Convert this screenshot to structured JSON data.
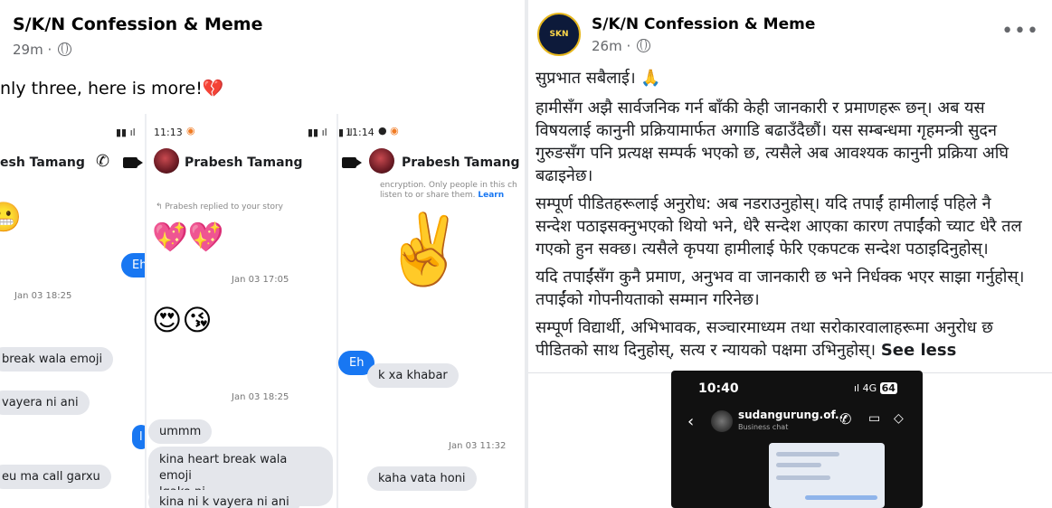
{
  "left_post": {
    "page_name": "S/K/N Confession & Meme",
    "time": "29m",
    "text": "nly three, here is more!",
    "heart_icon": "broken-heart",
    "screenshots": [
      {
        "chat_name": "esh Tamang",
        "messages": {
          "sent1": "Eh",
          "ts1": "Jan 03 18:25",
          "recv1": "break wala emoji",
          "recv2": "vayera ni ani",
          "recv3": "eu ma call garxu"
        }
      },
      {
        "status_time": "11:13",
        "chat_name": "Prabesh Tamang",
        "reply_note": "Prabesh replied to your story",
        "ts1": "Jan 03 17:05",
        "ts2": "Jan 03 18:25",
        "recv1": "ummm",
        "recv2a": "kina heart break wala emoji",
        "recv2b": "lgako ni",
        "recv3": "kina ni k vayera ni ani"
      },
      {
        "status_time": "11:14",
        "chat_name": "Prabesh Tamang",
        "note1": "encryption. Only people in this ch",
        "note2": "listen to or share them.",
        "note_link": "Learn",
        "sent1": "Eh",
        "recv1": "k xa khabar",
        "ts1": "Jan 03 11:32",
        "recv2": "kaha vata honi"
      }
    ]
  },
  "right_post": {
    "page_name": "S/K/N Confession & Meme",
    "logo_text": "SKN",
    "time": "26m",
    "paragraphs": [
      [
        "सुप्रभात सबैलाई। 🙏"
      ],
      [
        "हामीसँग अझै सार्वजनिक गर्न बाँकी केही जानकारी र प्रमाणहरू छन्। अब यस",
        "विषयलाई कानुनी प्रक्रियामार्फत अगाडि बढाउँदैछौं। यस सम्बन्धमा गृहमन्त्री सुदन",
        "गुरुङसँग पनि प्रत्यक्ष सम्पर्क भएको छ, त्यसैले अब आवश्यक कानुनी प्रक्रिया अघि",
        "बढाइनेछ।"
      ],
      [
        "सम्पूर्ण पीडितहरूलाई अनुरोध: अब नडराउनुहोस्। यदि तपाईं हामीलाई पहिले नै",
        "सन्देश पठाइसक्नुभएको थियो भने, धेरै सन्देश आएका कारण तपाईंको च्याट धेरै तल",
        "गएको हुन सक्छ। त्यसैले कृपया हामीलाई फेरि एकपटक सन्देश पठाइदिनुहोस्।"
      ],
      [
        "यदि तपाईंसँग कुनै प्रमाण, अनुभव वा जानकारी छ भने निर्धक्क भएर साझा गर्नुहोस्।",
        "तपाईंको गोपनीयताको सम्मान गरिनेछ।"
      ],
      [
        "सम्पूर्ण विद्यार्थी, अभिभावक, सञ्चारमाध्यम तथा सरोकारवालाहरूमा अनुरोध छ",
        "पीडितको साथ दिनुहोस्, सत्य र न्यायको पक्षमा उभिनुहोस्।"
      ]
    ],
    "see_less": "See less",
    "shot": {
      "time": "10:40",
      "network": "4G",
      "battery": "64",
      "username": "sudangurung.of...",
      "subtitle": "Business chat"
    }
  }
}
